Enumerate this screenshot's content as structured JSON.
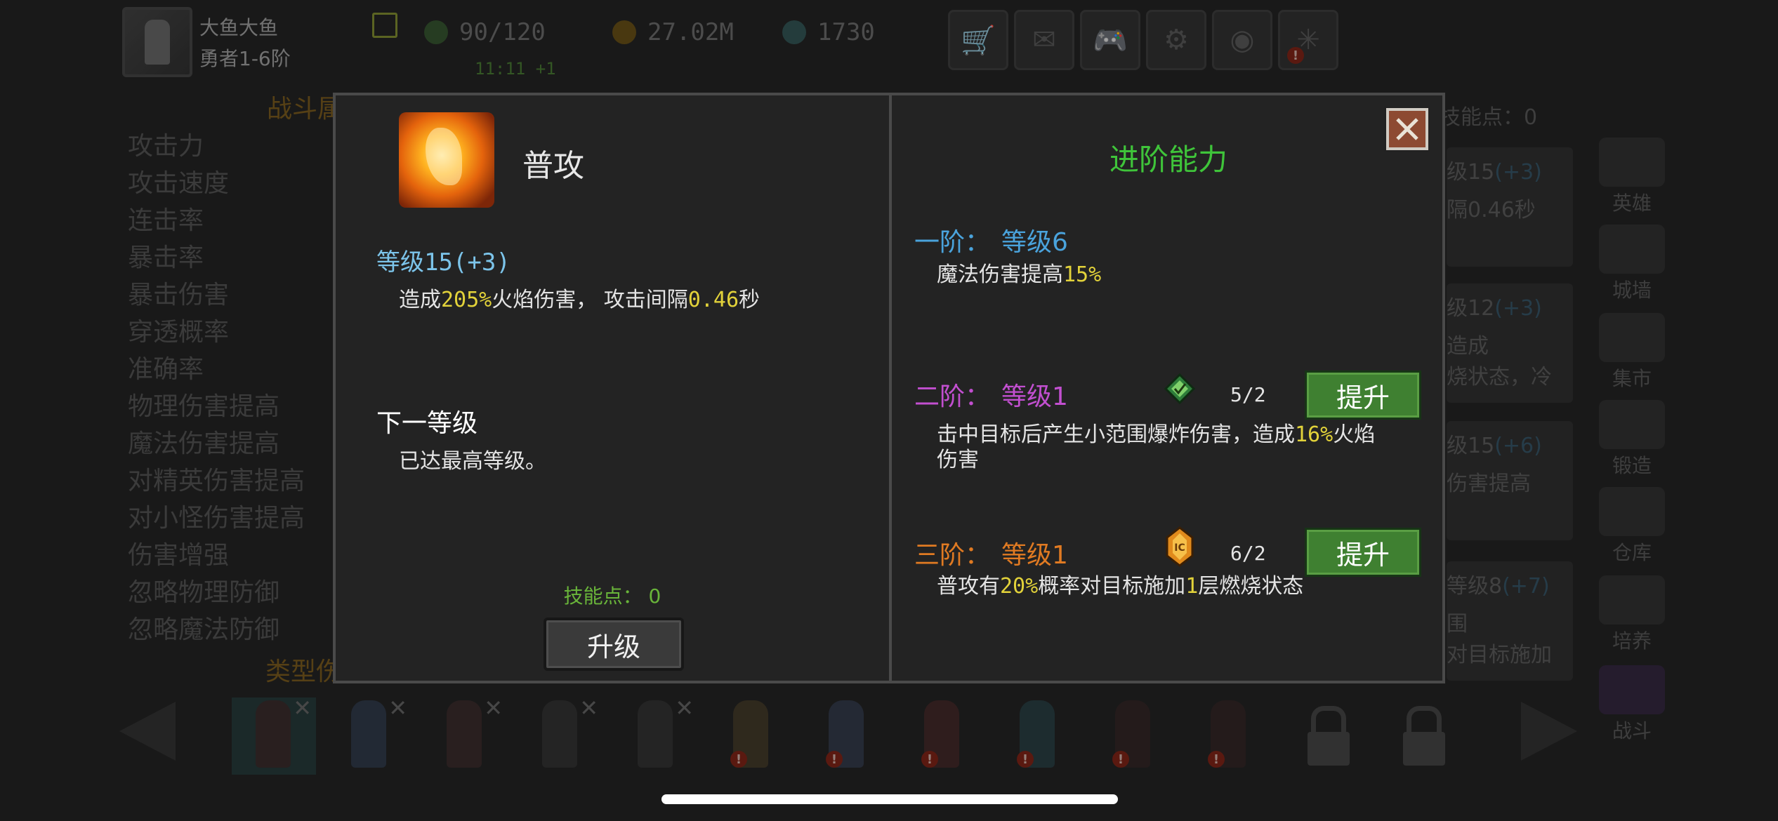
{
  "player": {
    "name": "大鱼大鱼",
    "rank": "勇者1-6阶"
  },
  "resources": {
    "energy": "90/120",
    "energy_timer": "11:11 +1",
    "gold": "27.02M",
    "gems": "1730"
  },
  "top_buttons": [
    "shop-cart-icon",
    "mail-icon",
    "gamepad-icon",
    "gear-icon",
    "color-wheel-icon",
    "spider-web-icon"
  ],
  "background": {
    "stats_title": "战斗属",
    "stats": [
      "攻击力",
      "攻击速度",
      "连击率",
      "暴击率",
      "暴击伤害",
      "穿透概率",
      "准确率",
      "物理伤害提高",
      "魔法伤害提高",
      "对精英伤害提高",
      "对小怪伤害提高",
      "伤害增强",
      "忽略物理防御",
      "忽略魔法防御"
    ],
    "type_title": "类型伤",
    "right_skill_points": "技能点：0",
    "right_cards": [
      [
        "级15",
        "(+3)",
        "隔0.46秒"
      ],
      [
        "级12",
        "(+3)",
        "造成",
        "烧状态，冷"
      ],
      [
        "级15",
        "(+6)",
        "伤害提高"
      ],
      [
        "等级8",
        "(+7)",
        "围",
        "对目标施加"
      ]
    ],
    "side_menu": [
      "英雄",
      "城墙",
      "集市",
      "锻造",
      "仓库",
      "培养",
      "战斗"
    ]
  },
  "modal": {
    "skill_name": "普攻",
    "level_label": "等级15(+3)",
    "desc_prefix": "造成",
    "desc_damage": "205%",
    "desc_mid": "火焰伤害， 攻击间隔",
    "desc_interval": "0.46",
    "desc_suffix": "秒",
    "next_level_title": "下一等级",
    "next_level_desc": "已达最高等级。",
    "skill_points": "技能点： 0",
    "upgrade_button": "升级",
    "advanced_title": "进阶能力",
    "tiers": [
      {
        "name": "一阶：",
        "level": "等级6",
        "desc_a": "魔法伤害提高",
        "desc_hl": "15%",
        "desc_b": "",
        "color": "#4aa3dc"
      },
      {
        "name": "二阶：",
        "level": "等级1",
        "cost": "5/2",
        "button": "提升",
        "desc_a": "击中目标后产生小范围爆炸伤害，造成",
        "desc_hl": "16%",
        "desc_b": "火焰伤害",
        "color": "#c24fd0"
      },
      {
        "name": "三阶：",
        "level": "等级1",
        "cost": "6/2",
        "button": "提升",
        "desc_a": "普攻有",
        "desc_hl": "20%",
        "desc_b": "概率对目标施加",
        "desc_hl2": "1",
        "desc_c": "层燃烧状态",
        "color": "#e07a22"
      }
    ]
  },
  "colors": {
    "highlight": "#e2d23a",
    "level_blue": "#7cc4ea",
    "green": "#3fc43a",
    "button_green": "#3f8031"
  }
}
